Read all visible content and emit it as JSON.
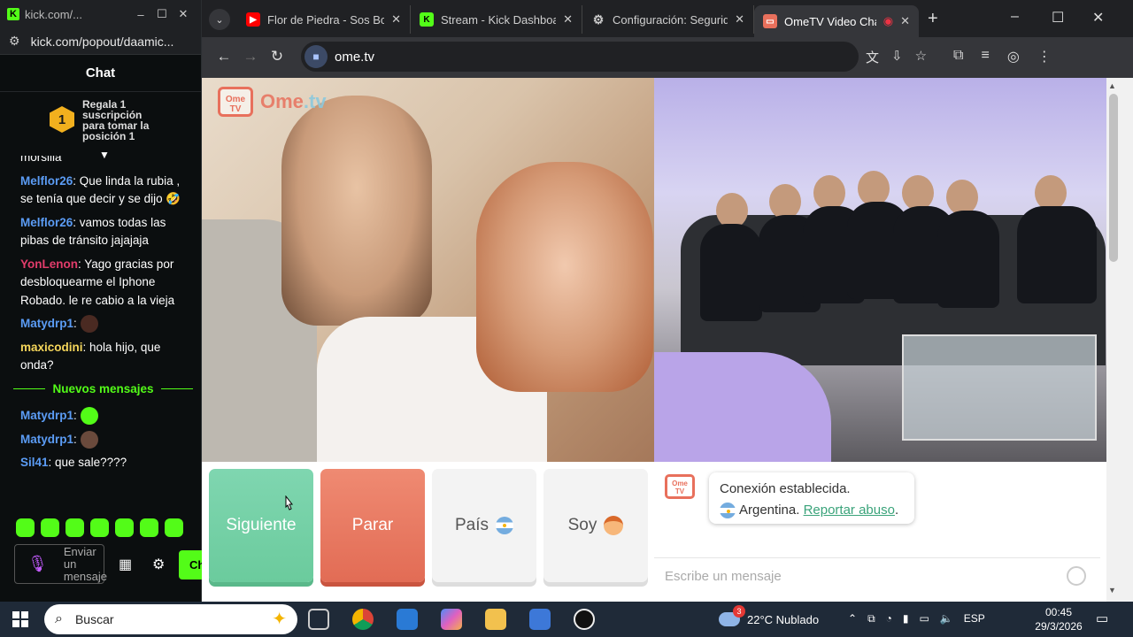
{
  "popout": {
    "title": "kick.com/...",
    "url": "kick.com/popout/daamic...",
    "chat_title": "Chat",
    "sub_rank": "1",
    "sub_text": "Regala 1 suscripción para tomar la posición 1",
    "messages": [
      {
        "user": "",
        "text": "morsilla",
        "color": "#ffffff"
      },
      {
        "user": "Melflor26",
        "text": ": Que linda la rubia , se tenía que decir y se dijo 🤣",
        "color": "#5b9cf5"
      },
      {
        "user": "Melflor26",
        "text": ": vamos todas las pibas de tránsito jajajaja",
        "color": "#5b9cf5"
      },
      {
        "user": "YonLenon",
        "text": ": Yago gracias por desbloquearme el Iphone Robado. le re cabio a la vieja",
        "color": "#e23c6b"
      },
      {
        "user": "Matydrp1",
        "text": ":",
        "color": "#5b9cf5"
      },
      {
        "user": "maxicodini",
        "text": ": hola hijo, que onda?",
        "color": "#f5d65b"
      }
    ],
    "new_messages_label": "Nuevos mensajes",
    "new_messages": [
      {
        "user": "Matydrp1",
        "text": ":",
        "color": "#5b9cf5"
      },
      {
        "user": "Matydrp1",
        "text": ":",
        "color": "#5b9cf5"
      },
      {
        "user": "Sil41",
        "text": ": que sale????",
        "color": "#5b9cf5"
      }
    ],
    "input_placeholder": "Enviar un mensaje",
    "send_label": "Ch"
  },
  "browser": {
    "tabs": [
      {
        "title": "Flor de Piedra - Sos Bot",
        "favicon": "youtube-icon",
        "color": "#ff0000"
      },
      {
        "title": "Stream - Kick Dashboar",
        "favicon": "kick-icon",
        "color": "#53fc18"
      },
      {
        "title": "Configuración: Segurid",
        "favicon": "gear-icon",
        "color": "#9aa0a6"
      },
      {
        "title": "OmeTV Video Chat",
        "favicon": "ometv-icon",
        "color": "#e8705c"
      }
    ],
    "url": "ome.tv"
  },
  "ometv": {
    "logo_badge": "Ome TV",
    "logo_word_a": "Ome",
    "logo_word_b": ".tv",
    "btn_next": "Siguiente",
    "btn_stop": "Parar",
    "btn_country": "País",
    "btn_gender": "Soy",
    "status_line1": "Conexión establecida.",
    "status_country": "Argentina.",
    "report_link": "Reportar abuso",
    "message_placeholder": "Escribe un mensaje"
  },
  "taskbar": {
    "search_placeholder": "Buscar",
    "weather_badge": "3",
    "weather": "22°C  Nublado",
    "lang": "ESP",
    "time": "00:45",
    "date": "29/3/2026"
  }
}
